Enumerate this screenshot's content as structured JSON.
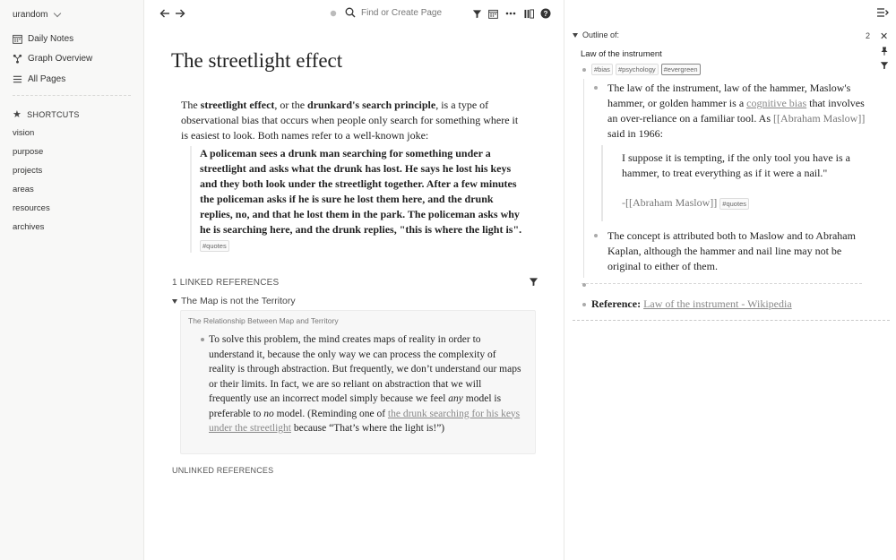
{
  "sidebar": {
    "graph_name": "urandom",
    "nav": [
      {
        "label": "Daily Notes",
        "icon": "calendar-icon"
      },
      {
        "label": "Graph Overview",
        "icon": "graph-icon"
      },
      {
        "label": "All Pages",
        "icon": "list-icon"
      }
    ],
    "shortcuts_heading": "SHORTCUTS",
    "shortcuts": [
      "vision",
      "purpose",
      "projects",
      "areas",
      "resources",
      "archives"
    ]
  },
  "topbar": {
    "search_placeholder": "Find or Create Page"
  },
  "page": {
    "title": "The streetlight effect",
    "intro": {
      "pre": "The ",
      "b1": "streetlight effect",
      "mid": ", or the ",
      "b2": "drunkard's search principle",
      "post": ", is a type of observational bias that occurs when people only search for something where it is easiest to look. Both names refer to a well-known joke:"
    },
    "quote": "A policeman sees a drunk man searching for something under a streetlight and asks what the drunk has lost. He says he lost his keys and they both look under the streetlight together. After a few minutes the policeman asks if he is sure he lost them here, and the drunk replies, no, and that he lost them in the park. The policeman asks why he is searching here, and the drunk replies, \"this is where the light is\".",
    "quote_tag": "#quotes"
  },
  "references": {
    "linked_heading": "1 LINKED REFERENCES",
    "ref_page": "The Map is not the Territory",
    "breadcrumb": "The Relationship Between Map and Territory",
    "text": {
      "p1": "To solve this problem, the mind creates maps of reality in order to understand it, because the only way we can process the complexity of reality is through abstraction. But frequently, we don’t understand our maps or their limits. In fact, we are so reliant on abstraction that we will frequently use an incorrect model simply because we feel ",
      "em1": "any",
      "p2": " model is preferable to ",
      "em2": "no",
      "p3": " model. (Reminding one of ",
      "link": "the drunk searching for his keys under the streetlight",
      "p4": " because “That’s where the light is!”)"
    },
    "unlinked_heading": "UNLINKED REFERENCES"
  },
  "right_panel": {
    "outline_label": "Outline of:",
    "count": "2",
    "title": "Law of the instrument",
    "tags": [
      "#bias",
      "#psychology",
      "#evergreen"
    ],
    "b1": {
      "pre": "The law of the instrument, law of the hammer, Maslow's hammer, or golden hammer is a ",
      "link": "cognitive bias",
      "mid": " that involves an over-reliance on a familiar tool. As ",
      "ref": "[[Abraham Maslow]]",
      "post": " said in 1966:"
    },
    "quote": "I suppose it is tempting, if the only tool you have is a hammer, to treat everything as if it were a nail.\"",
    "attribution": "-[[Abraham Maslow]]",
    "attribution_tag": "#quotes",
    "b2": "The concept is attributed both to Maslow and to Abraham Kaplan, although the hammer and nail line may not be original to either of them.",
    "reference_label": "Reference:",
    "reference_link": "Law of the instrument - Wikipedia"
  },
  "colors": {
    "sidebar_bg": "#f8f8f7",
    "text": "#222222",
    "muted": "#777777",
    "link": "#888888"
  }
}
